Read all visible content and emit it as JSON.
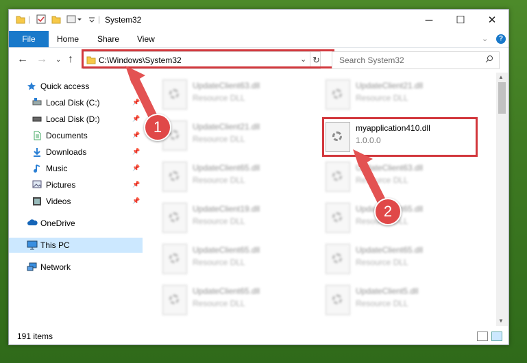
{
  "window": {
    "title": "System32",
    "buttons": {
      "minimize": "─",
      "maximize": "☐",
      "close": "✕"
    }
  },
  "ribbon": {
    "file": "File",
    "tabs": [
      "Home",
      "Share",
      "View"
    ],
    "help": "?"
  },
  "navigation": {
    "address": "C:\\Windows\\System32",
    "search_placeholder": "Search System32"
  },
  "sidebar": {
    "items": [
      {
        "label": "Quick access",
        "icon": "star-icon",
        "pinned": false
      },
      {
        "label": "Local Disk (C:)",
        "icon": "drive-icon",
        "pinned": true
      },
      {
        "label": "Local Disk (D:)",
        "icon": "drive-icon",
        "pinned": true
      },
      {
        "label": "Documents",
        "icon": "document-icon",
        "pinned": true
      },
      {
        "label": "Downloads",
        "icon": "download-icon",
        "pinned": true
      },
      {
        "label": "Music",
        "icon": "music-icon",
        "pinned": true
      },
      {
        "label": "Pictures",
        "icon": "pictures-icon",
        "pinned": true
      },
      {
        "label": "Videos",
        "icon": "videos-icon",
        "pinned": true
      },
      {
        "label": "OneDrive",
        "icon": "cloud-icon",
        "pinned": false
      },
      {
        "label": "This PC",
        "icon": "computer-icon",
        "pinned": false,
        "selected": true
      },
      {
        "label": "Network",
        "icon": "network-icon",
        "pinned": false
      }
    ]
  },
  "files": {
    "left": [
      {
        "name": "UpdateClient63.dll",
        "type": "Resource DLL"
      },
      {
        "name": "UpdateClient21.dll",
        "type": "Resource DLL"
      },
      {
        "name": "UpdateClient65.dll",
        "type": "Resource DLL"
      },
      {
        "name": "UpdateClient19.dll",
        "type": "Resource DLL"
      },
      {
        "name": "UpdateClient65.dll",
        "type": "Resource DLL"
      },
      {
        "name": "UpdateClient65.dll",
        "type": "Resource DLL"
      }
    ],
    "right": [
      {
        "name": "UpdateClient21.dll",
        "type": "Resource DLL"
      },
      {
        "name": "myapplication410.dll",
        "type": "1.0.0.0",
        "highlighted": true
      },
      {
        "name": "UpdateClient63.dll",
        "type": "Resource DLL"
      },
      {
        "name": "UpdateClient65.dll",
        "type": "Resource DLL"
      },
      {
        "name": "UpdateClient65.dll",
        "type": "Resource DLL"
      },
      {
        "name": "UpdateClient5.dll",
        "type": "Resource DLL"
      }
    ]
  },
  "status": {
    "items": "191 items"
  },
  "annotations": {
    "step1": "1",
    "step2": "2"
  },
  "colors": {
    "highlight": "#d2373c",
    "accent": "#1979ca",
    "selection": "#cce8ff"
  }
}
